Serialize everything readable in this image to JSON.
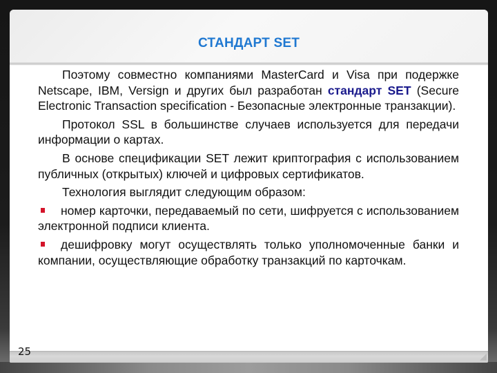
{
  "slide": {
    "title": "СТАНДАРТ SET",
    "page_number": "25",
    "paragraphs": [
      {
        "before": "Поэтому совместно компаниями MasterCard и Visa при подержке Netscape, IBM, Versign и других был разработан ",
        "highlight": "стандарт SET",
        "after": " (Secure Electronic Transaction specification - Безопасные электронные транзакции)."
      },
      {
        "text": "Протокол SSL в большинстве случаев используется для передачи информации о картах."
      },
      {
        "text": "В основе спецификации SET лежит криптография с использованием публичных (открытых) ключей и цифровых сертификатов."
      },
      {
        "text": "Технология выглядит следующим образом:"
      }
    ],
    "bullets": [
      {
        "text": "номер карточки, передаваемый по сети, шифруется с использованием электронной подписи клиента."
      },
      {
        "text": "дешифровку могут осуществлять только уполномоченные банки и компании, осуществляющие обработку транзакций по карточкам."
      }
    ],
    "colors": {
      "title": "#1f78d1",
      "highlight": "#1a1a8c",
      "bullet": "#d4142a"
    }
  }
}
